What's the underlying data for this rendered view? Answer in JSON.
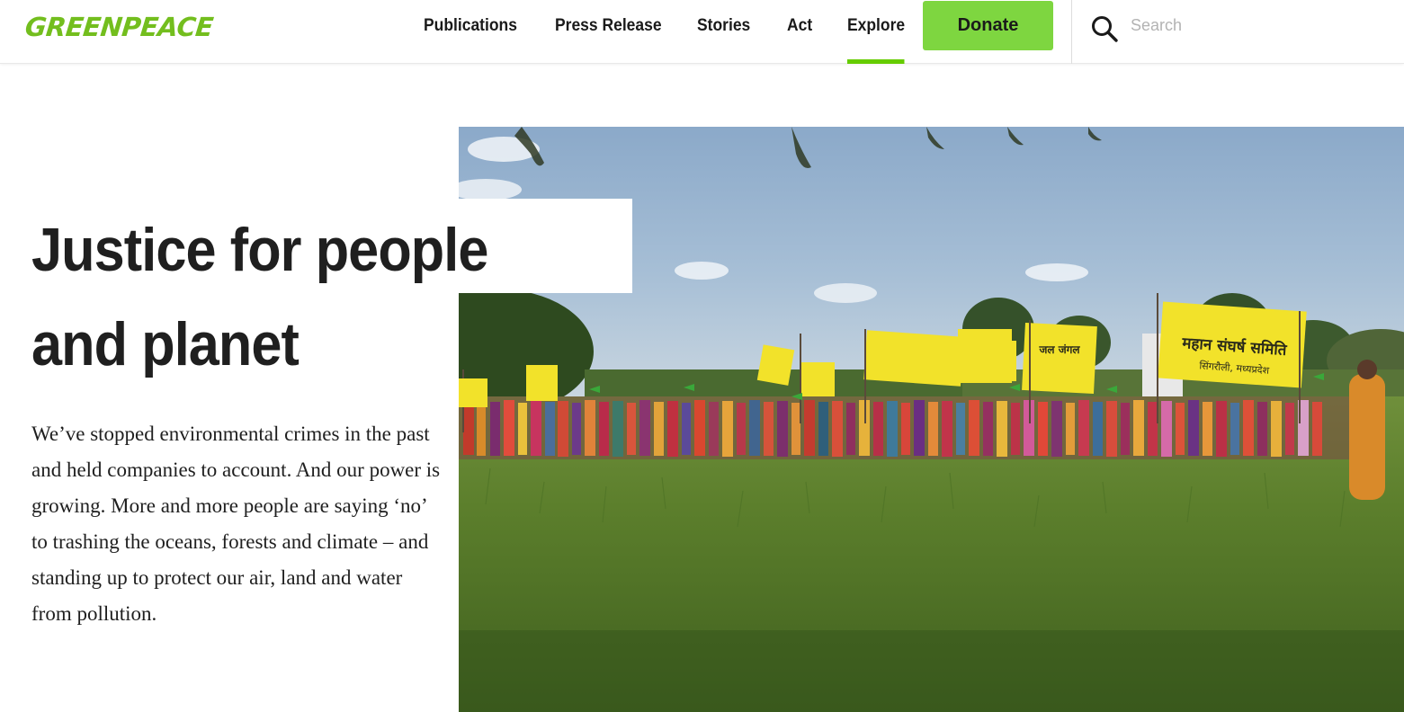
{
  "brand": {
    "logo_text": "GREENPEACE",
    "color": "#73be1e"
  },
  "nav": {
    "items": [
      {
        "label": "Publications"
      },
      {
        "label": "Press Release"
      },
      {
        "label": "Stories"
      },
      {
        "label": "Act"
      },
      {
        "label": "Explore",
        "active": true
      }
    ],
    "active_indicator_color": "#66cc00"
  },
  "donate": {
    "label": "Donate",
    "color": "#7ed640"
  },
  "search": {
    "placeholder": "Search",
    "value": "",
    "icon": "search-icon"
  },
  "hero": {
    "headline": "Justice for people and planet",
    "body": "We’ve stopped environmental crimes in the past and held companies to account. And our power is growing. More and more people are saying ‘no’ to trashing the oceans, forests and climate – and standing up to protect our air, land and water from pollution.",
    "image": {
      "banner_left_text": "महान संघर्ष समिति",
      "banner_left_subtext": "सिंगरौली, मध्यप्रदेश",
      "banner_center_text": "जल जंगल",
      "banner_accent_color": "#f2e22a"
    }
  }
}
